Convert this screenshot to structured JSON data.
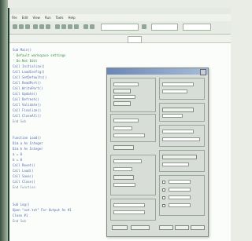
{
  "window": {
    "title": "",
    "tab_label": ""
  },
  "menubar": {
    "items": [
      "File",
      "Edit",
      "View",
      "Run",
      "Tools",
      "Help"
    ]
  },
  "code": {
    "lines": [
      "Sub Main()",
      "'  Default workspace settings",
      "' Do Not Edit",
      "    Call Initialize()",
      "    Call LoadConfig()",
      "    Call SetDefaults()",
      "    Call ReadPort()",
      "    Call WritePort()",
      "    Call Update()",
      "    Call Refresh()",
      "    Call Validate()",
      "    Call Finalize()",
      "    Call CloseAll()",
      "End Sub",
      "Function Load()",
      "    Dim a As Integer",
      "    Dim b As Integer",
      "    a = 0",
      "    b = 0",
      "    Call Reset()",
      "    Call Load()",
      "    Call Save()",
      "    Call Close()",
      "End Function",
      "Sub Log()",
      "    Open \"out.txt\" For Output As #1",
      "    Close #1",
      "End Sub"
    ]
  },
  "dialog": {
    "title": "",
    "labels": {
      "group_a": "",
      "group_b": "",
      "group_c": "",
      "group_d": ""
    },
    "buttons": {
      "ok": "",
      "cancel": "",
      "apply": ""
    },
    "fields": [
      "",
      "",
      "",
      "",
      "",
      "",
      "",
      ""
    ]
  }
}
